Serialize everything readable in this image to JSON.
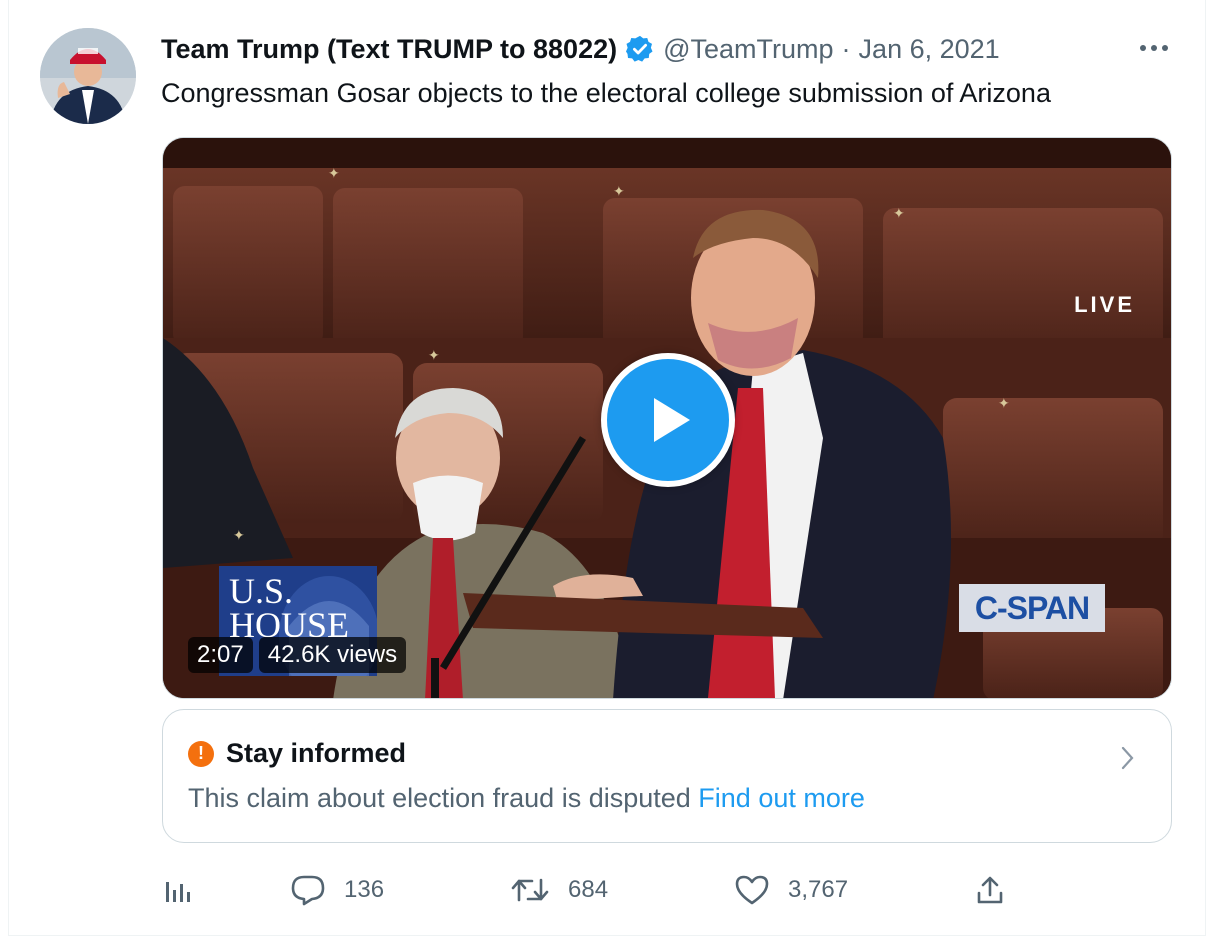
{
  "author": {
    "name": "Team Trump (Text TRUMP to 88022)",
    "handle": "@TeamTrump",
    "separator": "·",
    "date": "Jan 6, 2021",
    "verified": true
  },
  "tweet": {
    "text": "Congressman Gosar objects to the electoral college submission of Arizona"
  },
  "media": {
    "live_label": "LIVE",
    "chyron_left": "U.S.\nHOUSE",
    "chyron_right": "C-SPAN",
    "duration": "2:07",
    "views": "42.6K views"
  },
  "notice": {
    "title": "Stay informed",
    "body": "This claim about election fraud is disputed",
    "link": "Find out more"
  },
  "actions": {
    "analytics_icon": "bar-chart-icon",
    "replies": "136",
    "retweets": "684",
    "likes": "3,767"
  },
  "colors": {
    "accent": "#1d9bf0",
    "warning": "#f4700e",
    "secondary_text": "#536471"
  }
}
